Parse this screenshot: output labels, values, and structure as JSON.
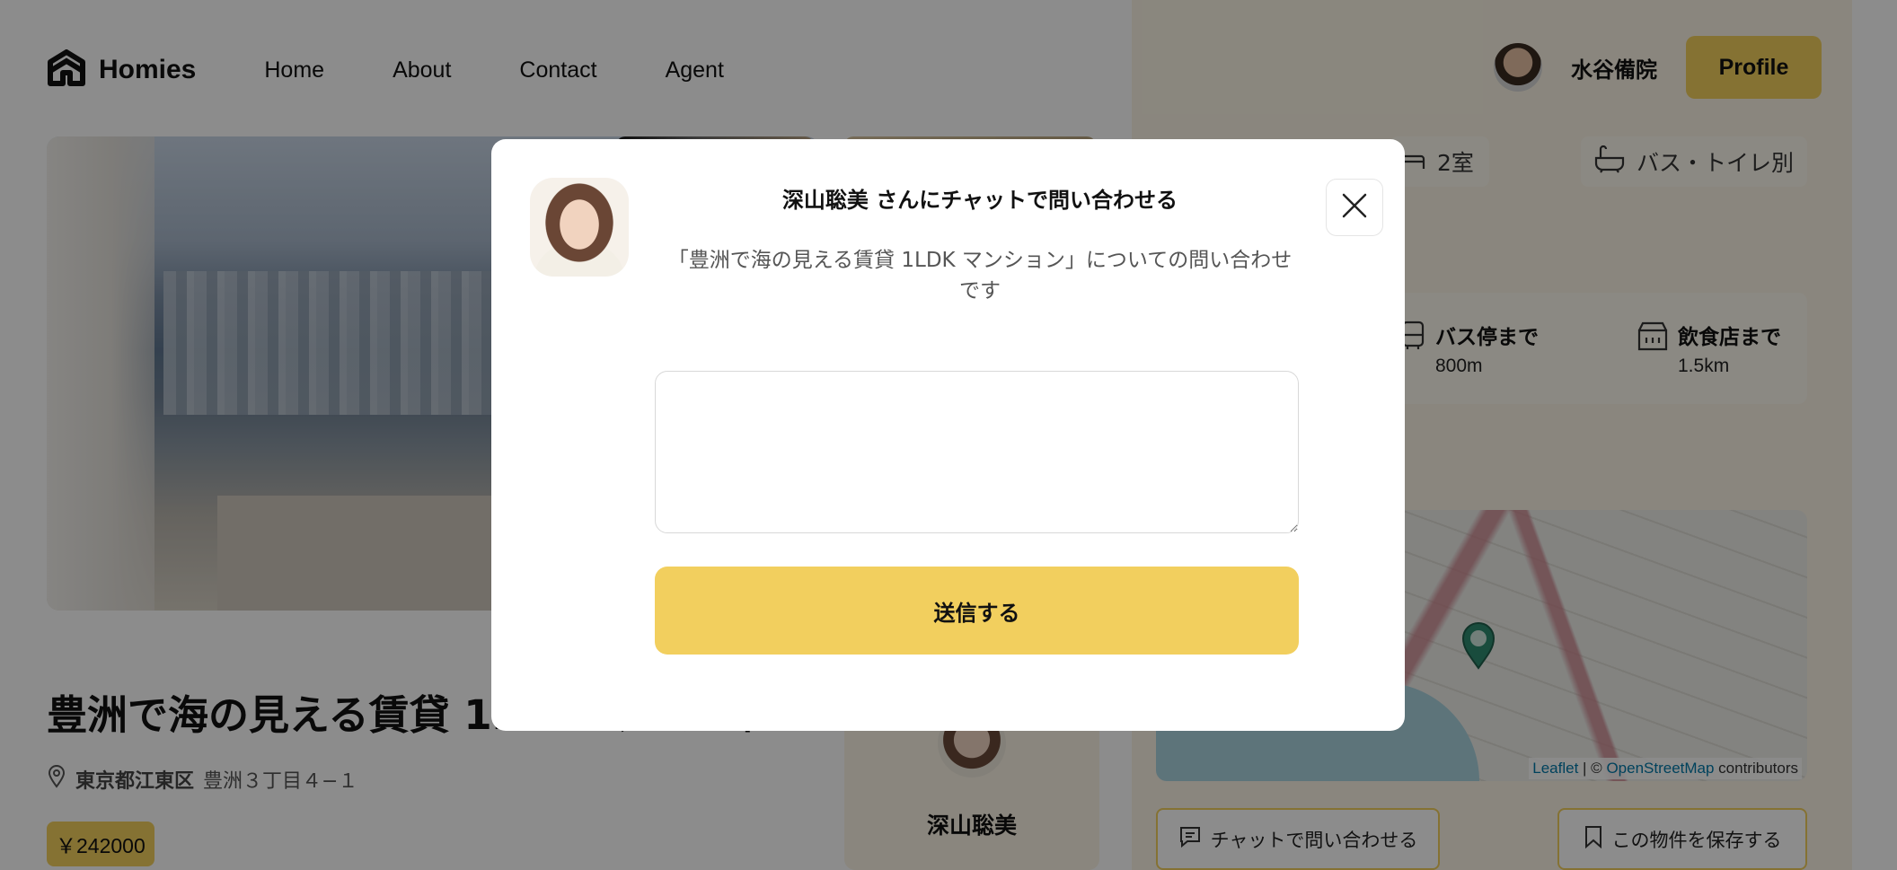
{
  "header": {
    "logo_text": "Homies",
    "nav": [
      "Home",
      "About",
      "Contact",
      "Agent"
    ],
    "user_name": "水谷備院",
    "profile_label": "Profile"
  },
  "listing": {
    "title": "豊洲で海の見える賃貸 1LDK マンション",
    "address_bold": "東京都江東区",
    "address_rest": "豊洲３丁目４−１",
    "price": "￥242000"
  },
  "agent_card": {
    "name": "深山聡美"
  },
  "features": {
    "rooms": "2室",
    "bath": "バス・トイレ別"
  },
  "distances": [
    {
      "label": "バス停まで",
      "value": "800m",
      "icon": "bus-icon"
    },
    {
      "label": "飲食店まで",
      "value": "1.5km",
      "icon": "restaurant-icon"
    }
  ],
  "map": {
    "attribution_leaflet": "Leaflet",
    "attribution_sep": " | © ",
    "attribution_osm": "OpenStreetMap",
    "attribution_tail": " contributors"
  },
  "actions": {
    "chat": "チャットで問い合わせる",
    "save": "この物件を保存する"
  },
  "modal": {
    "title": "深山聡美 さんにチャットで問い合わせる",
    "subtitle": "「豊洲で海の見える賃貸 1LDK マンション」についての問い合わせです",
    "message_value": "",
    "message_placeholder": "",
    "send_label": "送信する"
  },
  "colors": {
    "accent": "#f2cf5e",
    "overlay": "rgba(0,0,0,0.45)",
    "panel_bg": "#fcf5e5"
  }
}
